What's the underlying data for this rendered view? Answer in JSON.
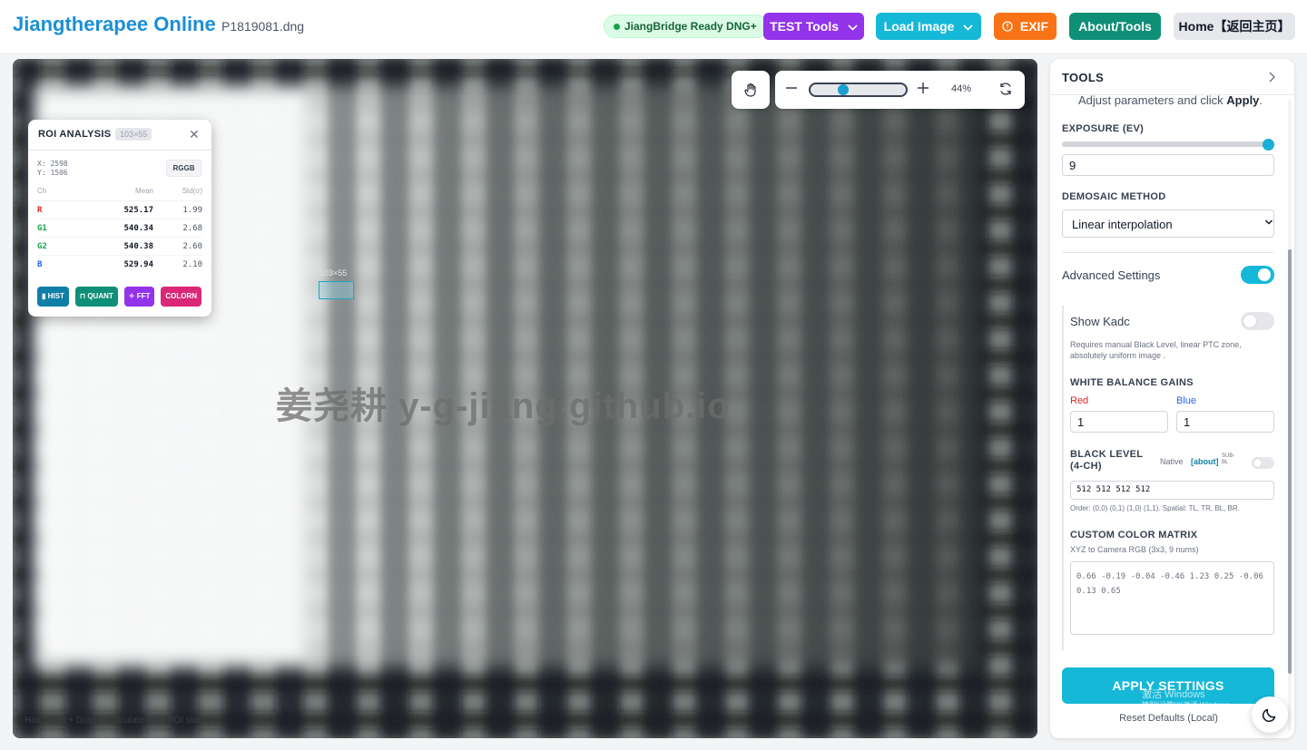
{
  "app": {
    "title": "Jiangtherapee Online",
    "filename": "P1819081.dng"
  },
  "header": {
    "status": "JiangBridge Ready DNG+",
    "buttons": {
      "test_tools": "TEST Tools",
      "load_image": "Load Image",
      "exif": "EXIF",
      "about_tools": "About/Tools",
      "home": "Home【返回主页】"
    },
    "colors": {
      "brand": "#1a8fd6",
      "test": "#9333ea",
      "load": "#16b8d8",
      "exif": "#f97316",
      "about": "#0f8f78"
    }
  },
  "viewer": {
    "zoom_label": "44%",
    "zoom_level": 0.44,
    "watermark": "姜尧耕 y-g-jiang.github.io",
    "hint_prefix": "Hold ",
    "hint_key": "Shift",
    "hint_suffix": " + Drag to calculate Raw ROI stats",
    "roi_size_label": "103×55"
  },
  "roi": {
    "title": "ROI ANALYSIS",
    "dims": "103×55",
    "x_label": "X: 2598",
    "y_label": "Y: 1506",
    "pattern": "RGGB",
    "headers": {
      "ch": "Ch",
      "mean": "Mean",
      "std": "Std(σ)"
    },
    "rows": [
      {
        "ch": "R",
        "mean": "525.17",
        "std": "1.99",
        "color": "#dc2626"
      },
      {
        "ch": "G1",
        "mean": "540.34",
        "std": "2.68",
        "color": "#16a34a"
      },
      {
        "ch": "G2",
        "mean": "540.38",
        "std": "2.60",
        "color": "#16a34a"
      },
      {
        "ch": "B",
        "mean": "529.94",
        "std": "2.10",
        "color": "#2563eb"
      }
    ],
    "actions": [
      {
        "label": "HIST",
        "color": "#0e7fa6"
      },
      {
        "label": "QUANT",
        "color": "#0f8f78"
      },
      {
        "label": "FFT",
        "color": "#9333ea"
      },
      {
        "label": "COLORN",
        "color": "#db2777"
      }
    ]
  },
  "tools": {
    "title": "TOOLS",
    "intro_prefix": "Adjust parameters and click ",
    "intro_bold": "Apply",
    "intro_suffix": ".",
    "exposure_label": "EXPOSURE (EV)",
    "exposure_value": "9",
    "exposure_slider_level": 1.0,
    "demosaic_label": "DEMOSAIC METHOD",
    "demosaic_value": "Linear interpolation",
    "advanced_label": "Advanced Settings",
    "advanced_on": true,
    "show_kadc_label": "Show Kadc",
    "show_kadc_on": false,
    "kadc_note": "Requires manual Black Level,  linear PTC zone, absolutely uniform image .",
    "wb_label": "WHITE BALANCE GAINS",
    "wb_red_label": "Red",
    "wb_blue_label": "Blue",
    "wb_red": "1",
    "wb_blue": "1",
    "black_label": "BLACK LEVEL (4-CH)",
    "black_native": "Native",
    "black_about": "[about]",
    "black_sub": "SUB-BL",
    "black_sub_on": false,
    "black_value": "512 512 512 512",
    "black_note": "Order: (0,0) (0,1) (1,0) (1,1). Spatial: TL, TR, BL, BR.",
    "matrix_label": "CUSTOM COLOR MATRIX",
    "matrix_sub": "XYZ to Camera RGB (3x3, 9 nums)",
    "matrix_placeholder": "0.66 -0.19 -0.04  -0.46 1.23 0.25  -0.06 0.13 0.65",
    "apply": "APPLY SETTINGS",
    "reset": "Reset Defaults (Local)"
  },
  "os_overlay": {
    "line1": "激活 Windows",
    "line2": "转到\"设置\"以激活 Windows。"
  }
}
